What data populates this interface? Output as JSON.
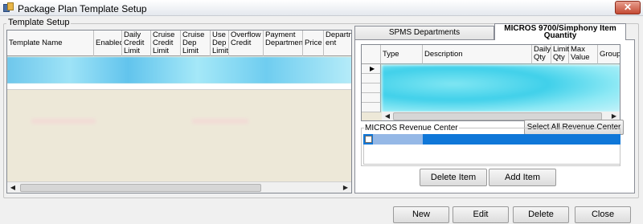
{
  "window": {
    "title": "Package Plan Template Setup",
    "close_label": "✕"
  },
  "group": {
    "label": "Template Setup"
  },
  "template_grid": {
    "columns": [
      "Template Name",
      "Enabled",
      "Daily Credit Limit",
      "Cruise Credit Limit",
      "Cruise Dep Limit",
      "Use Dep Limit",
      "Overflow Credit",
      "Payment Department",
      "Price",
      "Departm ent"
    ]
  },
  "tabs": {
    "spms": "SPMS Departments",
    "micros": "MICROS 9700/Simphony Item Quantity"
  },
  "item_grid": {
    "columns": [
      "Type",
      "Description",
      "Daily Qty",
      "Limit Qty",
      "Max Value",
      "Group"
    ]
  },
  "revenue_center": {
    "label": "MICROS Revenue Center",
    "select_all": "Select All Revenue Center"
  },
  "item_buttons": {
    "delete": "Delete Item",
    "add": "Add Item"
  },
  "footer": {
    "new": "New",
    "edit": "Edit",
    "delete": "Delete",
    "close": "Close"
  },
  "colors": {
    "selection": "#0f77d8",
    "grid_bg": "#ede8d8",
    "blurred_row": "#6ec7ec"
  }
}
